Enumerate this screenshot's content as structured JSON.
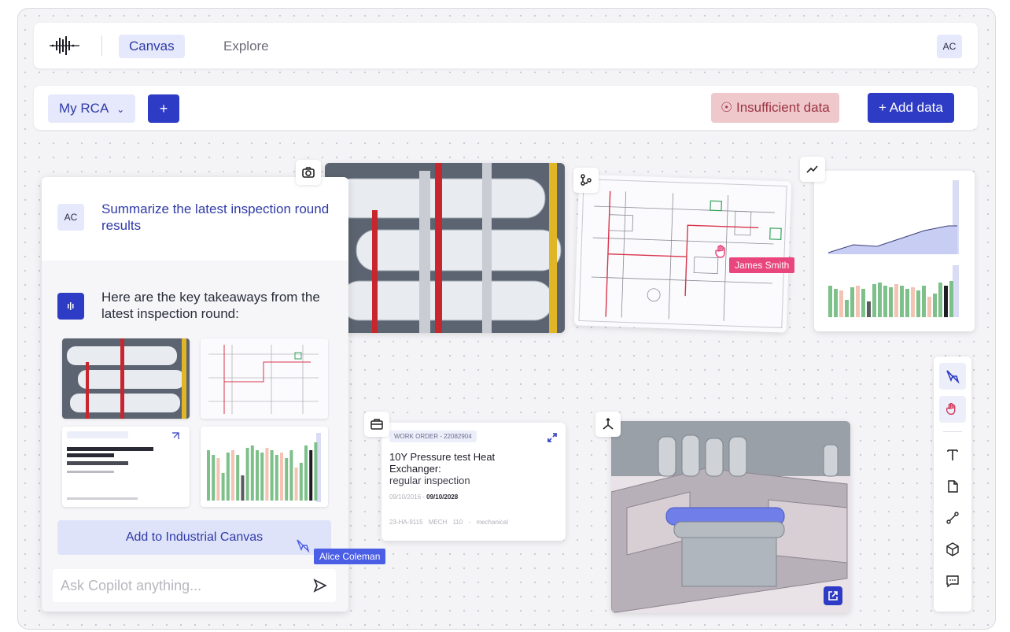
{
  "topbar": {
    "tabs": [
      {
        "label": "Canvas",
        "active": true
      },
      {
        "label": "Explore",
        "active": false
      }
    ],
    "user_initials": "AC"
  },
  "toolbar": {
    "rca_label": "My RCA",
    "add_label": "+",
    "insufficient_label": "Insufficient data",
    "add_data_label": "+ Add data"
  },
  "copilot": {
    "user_initials": "AC",
    "question": "Summarize the latest inspection round results",
    "answer": "Here are the key takeaways from the latest inspection round:",
    "add_button": "Add to Industrial Canvas",
    "ask_placeholder": "Ask Copilot anything..."
  },
  "work_order": {
    "tag": "WORK ORDER - 22082904",
    "title": "10Y Pressure test Heat Exchanger:",
    "subtitle": "regular inspection",
    "date_from": "09/10/2016",
    "date_to": "09/10/2028",
    "footer": [
      "23-HA-9115",
      "MECH",
      "110 - mechanical"
    ]
  },
  "cursors": [
    {
      "name": "James Smith",
      "color": "#e8467c"
    },
    {
      "name": "Alice Coleman",
      "color": "#4a5ee6"
    }
  ],
  "colors": {
    "accent": "#2e3bc4",
    "accent_light": "#e6e9fb",
    "warning_bg": "#efc8cc",
    "warning_text": "#9b3443"
  }
}
